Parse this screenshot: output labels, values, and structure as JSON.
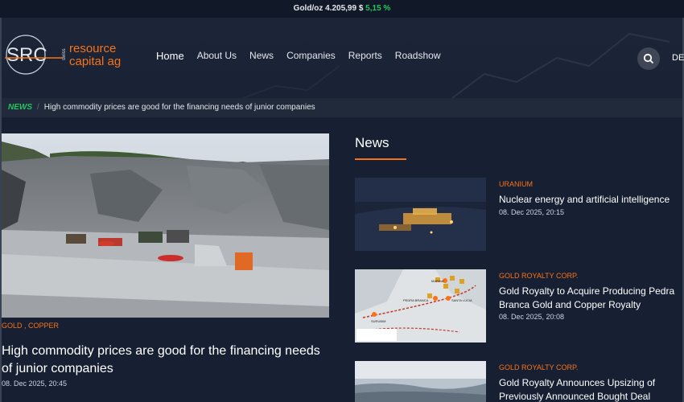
{
  "ticker": {
    "label": "Gold/oz 4.205,99 $",
    "change": "5,15 %"
  },
  "logo": {
    "mark": "SRC",
    "line1": "resource",
    "line2": "capital ag",
    "vertical": "swiss"
  },
  "nav": {
    "items": [
      "Home",
      "About Us",
      "News",
      "Companies",
      "Reports",
      "Roadshow"
    ],
    "active": "Home"
  },
  "header": {
    "lang": "DE"
  },
  "breadcrumb": {
    "section": "NEWS",
    "title": "High commodity prices are good for the financing needs of junior companies"
  },
  "hero": {
    "tags": "GOLD , COPPER",
    "title": "High commodity prices are good for the financing needs of junior companies",
    "date": "08. Dec 2025, 20:45"
  },
  "news": {
    "heading": "News",
    "items": [
      {
        "category": "URANIUM",
        "title": "Nuclear energy and artificial intelligence",
        "date": "08. Dec 2025, 20:15"
      },
      {
        "category": "GOLD ROYALTY CORP.",
        "title": "Gold Royalty to Acquire Producing Pedra Branca Gold and Copper Royalty",
        "date": "08. Dec 2025, 20:08"
      },
      {
        "category": "GOLD ROYALTY CORP.",
        "title": "Gold Royalty Announces Upsizing of Previously Announced Bought Deal",
        "date": ""
      }
    ],
    "map_labels": [
      "PEDRA BRANCA",
      "SANTA LUCIA",
      "MARINA",
      "SURUBIM"
    ]
  },
  "colors": {
    "accent": "#f97316",
    "positive": "#22c55e",
    "background": "#172033"
  }
}
